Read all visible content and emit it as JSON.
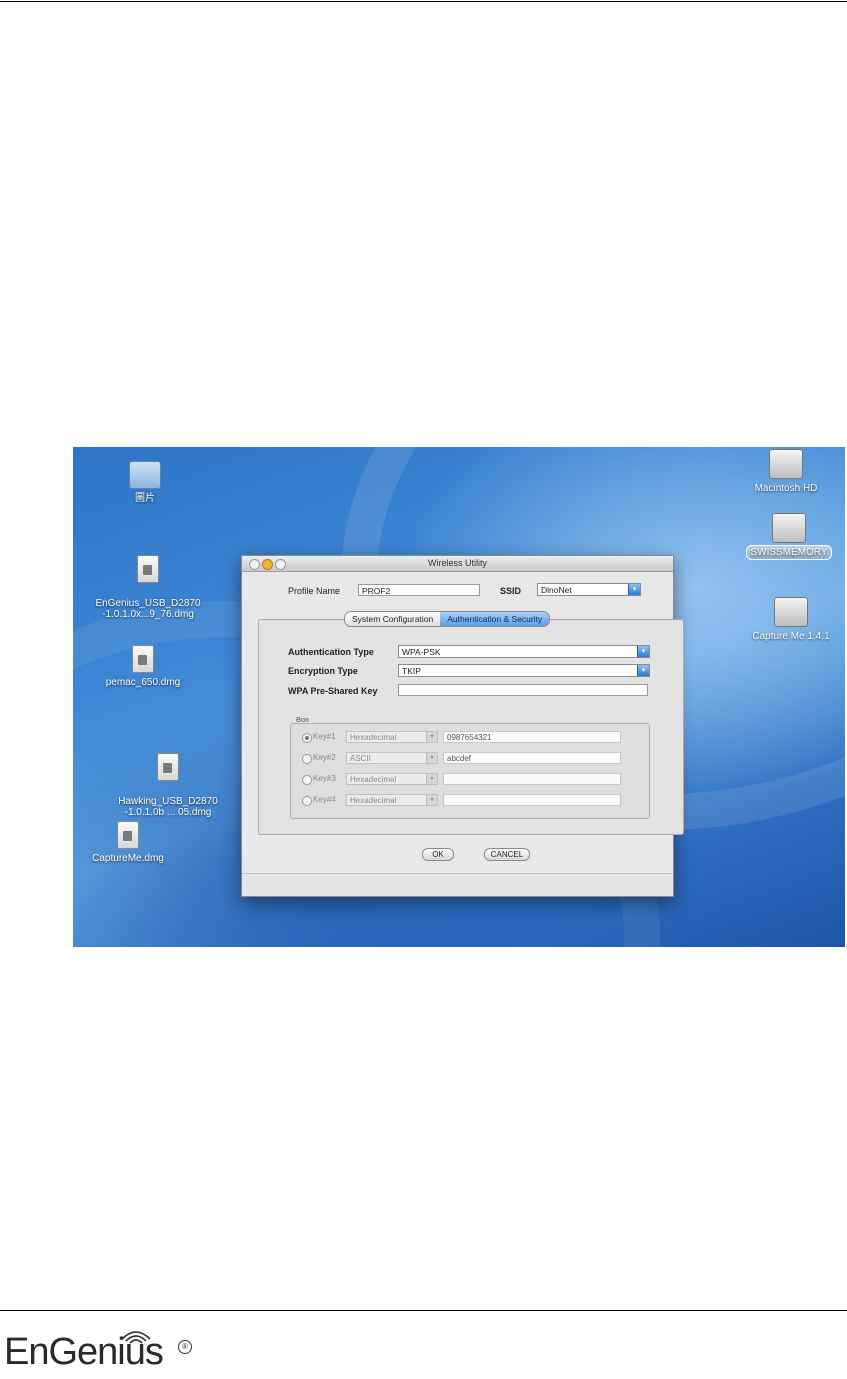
{
  "desktop": {
    "icons_left": [
      {
        "label": "圖片",
        "kind": "folder-icon"
      },
      {
        "label": "EnGenius_USB_D2870\n-1.0.1.0x...9_76.dmg",
        "kind": "disk-image-icon"
      },
      {
        "label": "pemac_650.dmg",
        "kind": "disk-image-icon"
      },
      {
        "label": "Hawking_USB_D2870\n-1.0.1.0b ... 05.dmg",
        "kind": "disk-image-icon"
      },
      {
        "label": "CaptureMe.dmg",
        "kind": "disk-image-icon"
      }
    ],
    "icons_right": [
      {
        "label": "Macintosh HD",
        "kind": "hard-drive-icon"
      },
      {
        "label": "SWISSMEMORY",
        "kind": "usb-drive-icon"
      },
      {
        "label": "Capture Me 1.4.1",
        "kind": "mounted-volume-icon"
      }
    ]
  },
  "window": {
    "title": "Wireless Utility",
    "profile_name_label": "Profile Name",
    "profile_name_value": "PROF2",
    "ssid_label": "SSID",
    "ssid_value": "DlnoNet",
    "tabs": [
      {
        "label": "System Configuration",
        "active": false
      },
      {
        "label": "Authentication & Security",
        "active": true
      }
    ],
    "auth_type_label": "Authentication Type",
    "auth_type_value": "WPA-PSK",
    "encryption_type_label": "Encryption Type",
    "encryption_type_value": "TKIP",
    "psk_label": "WPA Pre-Shared Key",
    "psk_value": "",
    "wep_group_title": "Box",
    "keys": [
      {
        "name": "Key#1",
        "format": "Hexadecimal",
        "value": "0987654321",
        "selected": true
      },
      {
        "name": "Key#2",
        "format": "ASCII",
        "value": "abcdef",
        "selected": false
      },
      {
        "name": "Key#3",
        "format": "Hexadecimal",
        "value": "",
        "selected": false
      },
      {
        "name": "Key#4",
        "format": "Hexadecimal",
        "value": "",
        "selected": false
      }
    ],
    "ok_label": "OK",
    "cancel_label": "CANCEL"
  },
  "footer": {
    "logo_text": "EnGenius",
    "logo_mark": "®"
  }
}
